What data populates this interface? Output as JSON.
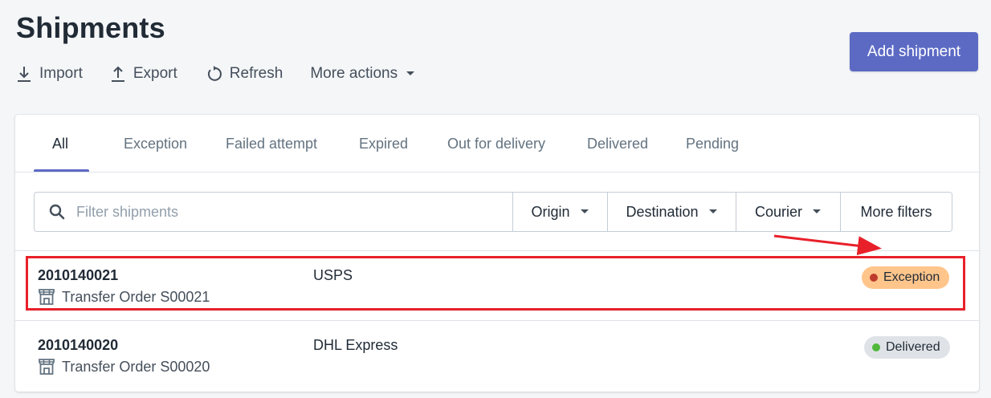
{
  "page": {
    "title": "Shipments"
  },
  "actions": [
    {
      "label": "Import",
      "icon": "import-icon"
    },
    {
      "label": "Export",
      "icon": "export-icon"
    },
    {
      "label": "Refresh",
      "icon": "refresh-icon"
    },
    {
      "label": "More actions",
      "icon": "caret-down-icon"
    }
  ],
  "primary_button": {
    "label": "Add shipment"
  },
  "tabs": [
    {
      "label": "All",
      "active": true
    },
    {
      "label": "Exception"
    },
    {
      "label": "Failed attempt"
    },
    {
      "label": "Expired"
    },
    {
      "label": "Out for delivery"
    },
    {
      "label": "Delivered"
    },
    {
      "label": "Pending"
    }
  ],
  "filters": {
    "search_placeholder": "Filter shipments",
    "origin": "Origin",
    "destination": "Destination",
    "courier": "Courier",
    "more": "More filters"
  },
  "shipments": [
    {
      "tracking": "2010140021",
      "order": "Transfer Order S00021",
      "courier": "USPS",
      "status": "Exception",
      "status_bg": "#ffc58b",
      "status_dot": "#bf0711",
      "highlighted": true
    },
    {
      "tracking": "2010140020",
      "order": "Transfer Order S00020",
      "courier": "DHL Express",
      "status": "Delivered",
      "status_bg": "#dfe3e8",
      "status_dot": "#50b83c"
    }
  ],
  "colors": {
    "primary": "#5c6ac4",
    "annotation": "#e8202a"
  }
}
